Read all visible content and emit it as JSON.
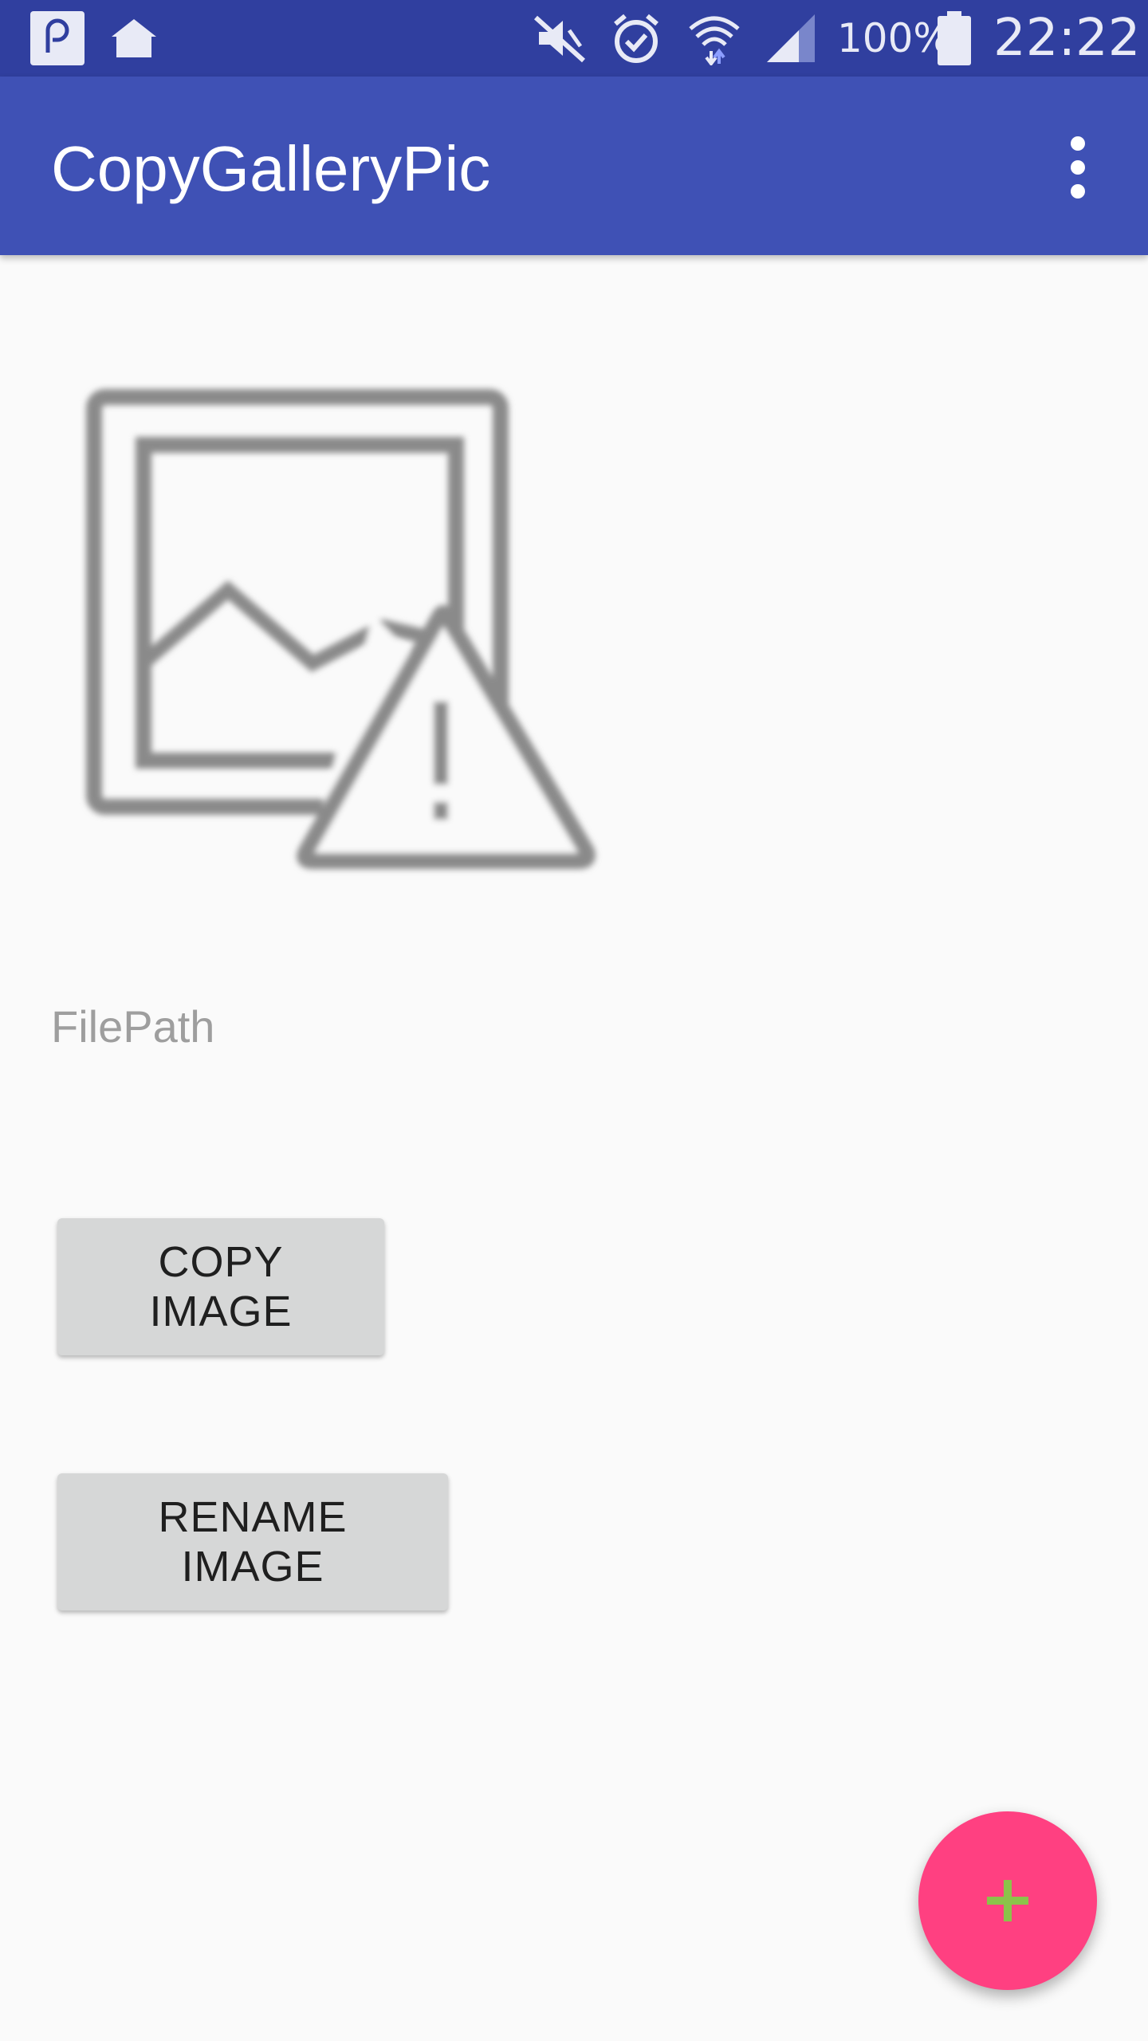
{
  "status_bar": {
    "battery_percent": "100%",
    "time": "22:22",
    "icons": [
      "notification-app-icon",
      "home-icon",
      "mute-icon",
      "alarm-icon",
      "wifi-icon",
      "signal-icon",
      "battery-icon"
    ]
  },
  "app_bar": {
    "title": "CopyGalleryPic",
    "overflow_icon": "more-vert-icon"
  },
  "content": {
    "image_placeholder_icon": "broken-image-icon",
    "file_path_label": "FilePath",
    "copy_button_label": "COPY IMAGE",
    "rename_button_label": "RENAME IMAGE"
  },
  "fab": {
    "icon": "plus-icon",
    "glyph": "+"
  },
  "colors": {
    "status_bar": "#303f9f",
    "app_bar": "#3f51b5",
    "background": "#fafafa",
    "button": "#d6d7d7",
    "fab": "#ff4081",
    "fab_icon": "#8bc34a"
  }
}
